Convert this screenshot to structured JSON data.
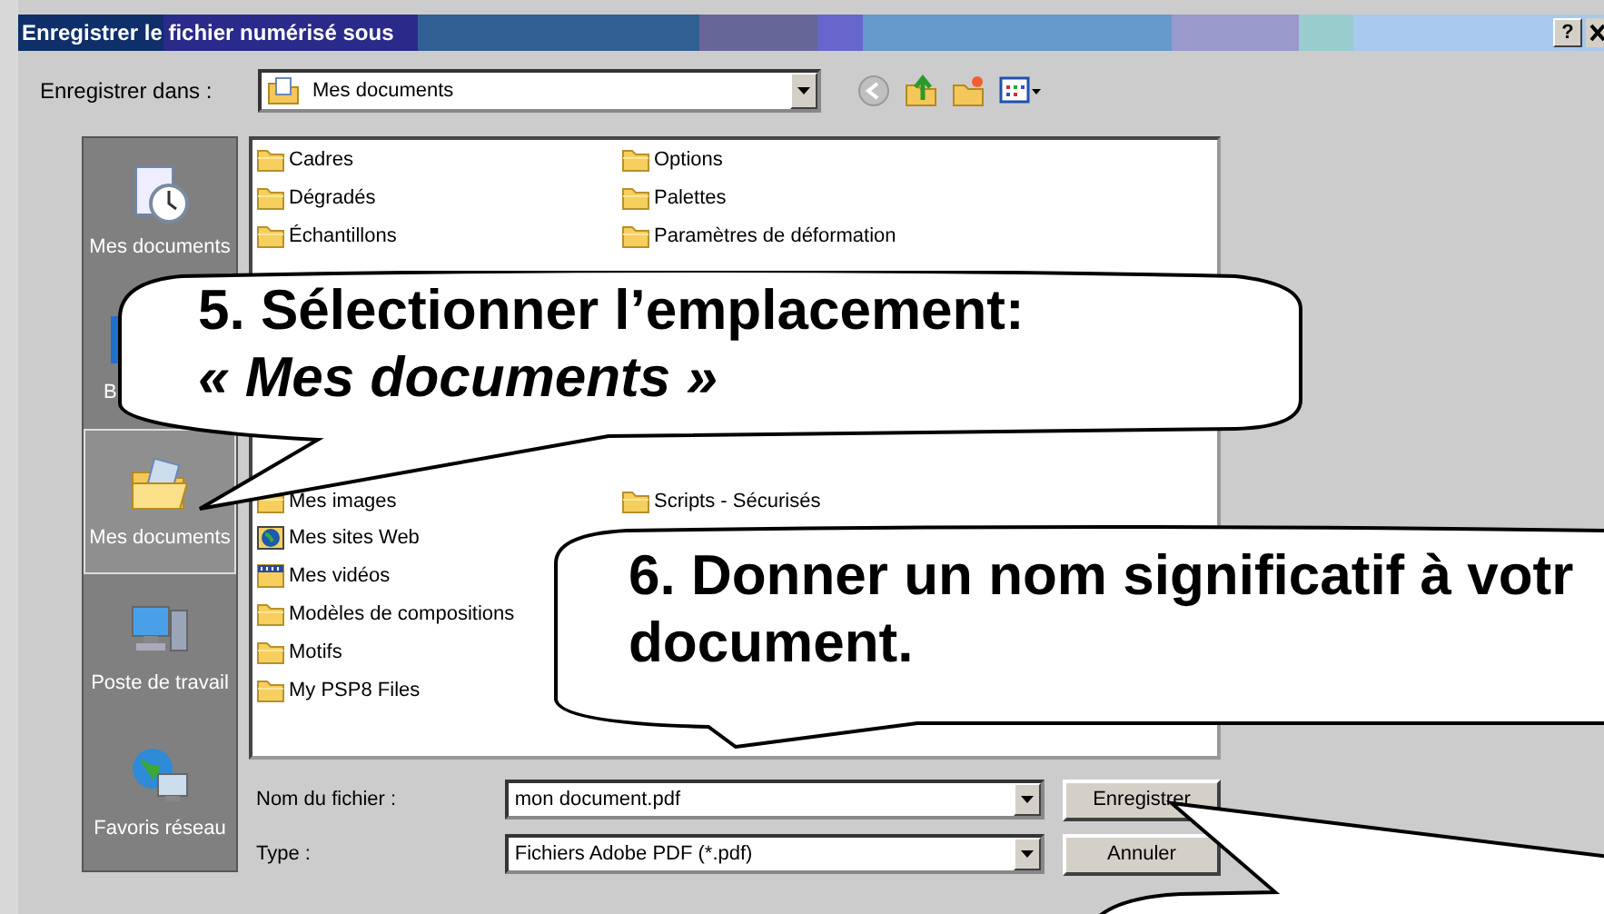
{
  "window": {
    "title": "Enregistrer le fichier numérisé sous",
    "help": "?"
  },
  "save_in": {
    "label": "Enregistrer dans :",
    "value": "Mes documents"
  },
  "places": [
    {
      "label": "Mes documents",
      "kind": "recent",
      "selected": false
    },
    {
      "label": "B",
      "kind": "desktop",
      "selected": false
    },
    {
      "label": "Mes documents",
      "kind": "documents",
      "selected": true
    },
    {
      "label": "Poste de travail",
      "kind": "computer",
      "selected": false
    },
    {
      "label": "Favoris réseau",
      "kind": "network",
      "selected": false
    }
  ],
  "files": [
    [
      {
        "name": "Cadres",
        "kind": "folder"
      },
      {
        "name": "Dégradés",
        "kind": "folder"
      },
      {
        "name": "Échantillons",
        "kind": "folder"
      },
      {
        "kind": "covered"
      },
      {
        "kind": "covered"
      },
      {
        "kind": "covered"
      },
      {
        "kind": "covered"
      },
      {
        "kind": "covered"
      },
      {
        "kind": "covered"
      },
      {
        "name": "Mes images",
        "kind": "folder"
      },
      {
        "name": "Mes sites Web",
        "kind": "web"
      },
      {
        "name": "Mes vidéos",
        "kind": "video"
      },
      {
        "name": "Modèles de compositions",
        "kind": "folder"
      },
      {
        "name": "Motifs",
        "kind": "folder"
      },
      {
        "name": "My PSP8 Files",
        "kind": "folder"
      }
    ],
    [
      {
        "name": "Options",
        "kind": "folder"
      },
      {
        "name": "Palettes",
        "kind": "folder"
      },
      {
        "name": "Paramètres de déformation",
        "kind": "folder"
      },
      {
        "kind": "covered"
      },
      {
        "kind": "covered"
      },
      {
        "kind": "covered"
      },
      {
        "kind": "covered"
      },
      {
        "kind": "covered"
      },
      {
        "kind": "covered"
      },
      {
        "name": "Scripts - Sécurisés",
        "kind": "folder"
      }
    ]
  ],
  "filename": {
    "label": "Nom du fichier :",
    "value": "mon document.pdf"
  },
  "filetype": {
    "label": "Type :",
    "value": "Fichiers Adobe PDF (*.pdf)"
  },
  "buttons": [
    "Enregistrer",
    "Annuler"
  ],
  "callouts": [
    {
      "lines": [
        "5. Sélectionner l’emplacement:",
        "« Mes documents »"
      ]
    },
    {
      "lines": [
        "6. Donner un nom significatif à votr",
        "document."
      ]
    }
  ]
}
